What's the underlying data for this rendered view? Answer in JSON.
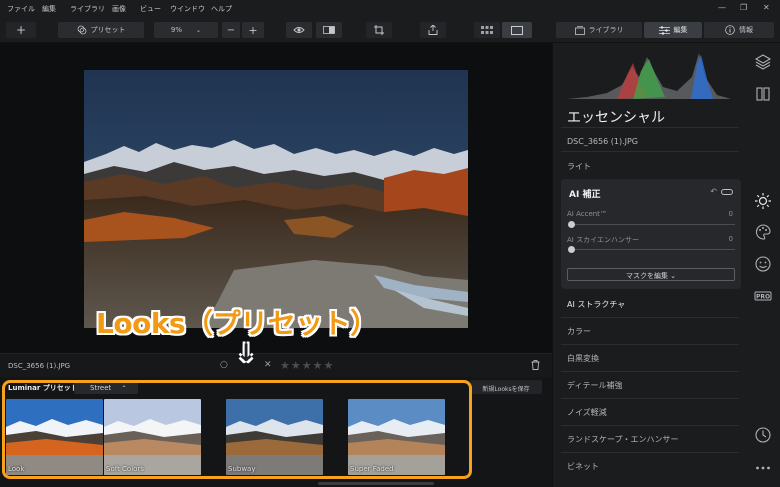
{
  "menubar": {
    "items": [
      "ファイル",
      "編集",
      "ライブラリ",
      "画像",
      "ビュー",
      "ウインドウ",
      "ヘルプ"
    ],
    "window_controls": [
      "—",
      "❐",
      "✕"
    ]
  },
  "toolbar": {
    "add_label": "+",
    "preset_label": "プリセット",
    "zoom_value": "9%",
    "zoom_minus": "−",
    "zoom_plus": "+",
    "tabs": [
      "ライブラリ",
      "編集",
      "情報"
    ]
  },
  "canvas": {
    "filename": "DSC_3656 (1).JPG"
  },
  "infobar": {
    "filename": "DSC_3656 (1).JPG",
    "stars": "★★★★★",
    "reject": "✕"
  },
  "presets": {
    "collection": "Luminar プリセット",
    "category": "Street",
    "save_label": "新規Looksを保存",
    "items": [
      {
        "label": "Look"
      },
      {
        "label": "Soft Colors"
      },
      {
        "label": "Subway"
      },
      {
        "label": "Super Faded"
      }
    ]
  },
  "annotation": {
    "label": "Looks（プリセット）",
    "arrow": "↓",
    "color": "#f29a16"
  },
  "panel": {
    "title": "エッセンシャル",
    "filename": "DSC_3656 (1).JPG",
    "light": "ライト",
    "ai": {
      "title": "AI 補正",
      "sliders": [
        {
          "label": "AI Accent™",
          "value": "0"
        },
        {
          "label": "AI スカイエンハンサー",
          "value": "0"
        }
      ],
      "mask_button": "マスクを編集 ⌄"
    },
    "sections": [
      "AI ストラクチャ",
      "カラー",
      "白黒変換",
      "ディテール補強",
      "ノイズ軽減",
      "ランドスケープ・エンハンサー",
      "ビネット"
    ]
  },
  "icons": [
    "layers-icon",
    "compare-icon",
    "sun-icon",
    "palette-icon",
    "face-icon",
    "pro-icon",
    "clock-icon",
    "more-icon"
  ],
  "colors": {
    "accent": "#f6a21a",
    "panel": "#1b1c1e",
    "background": "#0e0f10"
  }
}
